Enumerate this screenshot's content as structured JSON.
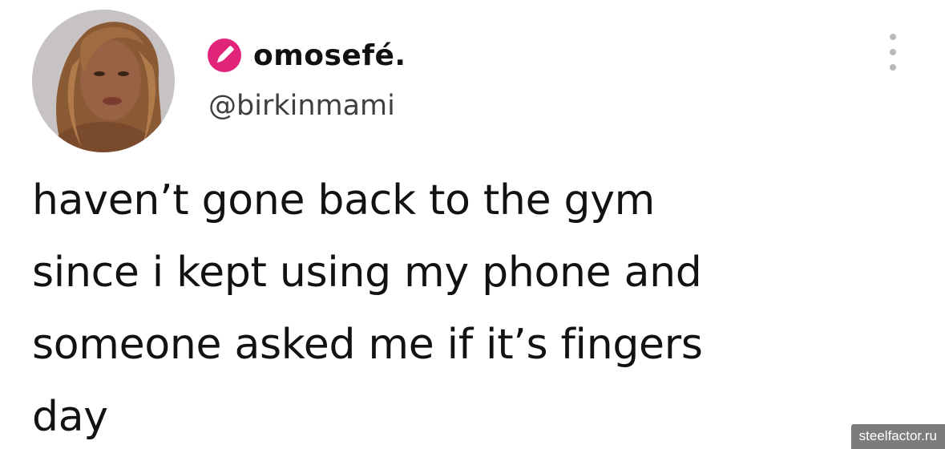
{
  "author": {
    "display_name": "omosefé.",
    "handle": "@birkinmami",
    "badge_icon": "pen-badge-icon",
    "badge_color": "#e0247a",
    "avatar_icon": "profile-photo"
  },
  "menu": {
    "icon": "more-options-icon"
  },
  "tweet": {
    "text": "haven’t gone back to the gym\nsince i kept using my phone and\nsomeone asked me if it’s fingers\nday"
  },
  "watermark": {
    "text": "steelfactor.ru"
  }
}
